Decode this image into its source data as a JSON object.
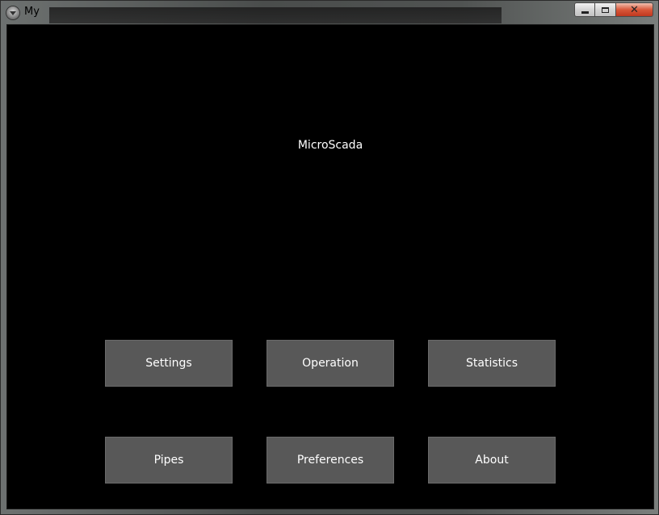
{
  "window": {
    "title": "My",
    "icon": "app-icon",
    "controls": {
      "minimize_icon": "minimize-icon",
      "maximize_icon": "maximize-icon",
      "close_icon": "close-icon"
    }
  },
  "app": {
    "title": "MicroScada"
  },
  "menu": {
    "buttons": [
      {
        "label": "Settings"
      },
      {
        "label": "Operation"
      },
      {
        "label": "Statistics"
      },
      {
        "label": "Pipes"
      },
      {
        "label": "Preferences"
      },
      {
        "label": "About"
      }
    ]
  },
  "colors": {
    "background": "#000000",
    "button_fill": "#585858",
    "button_text": "#ffffff"
  }
}
